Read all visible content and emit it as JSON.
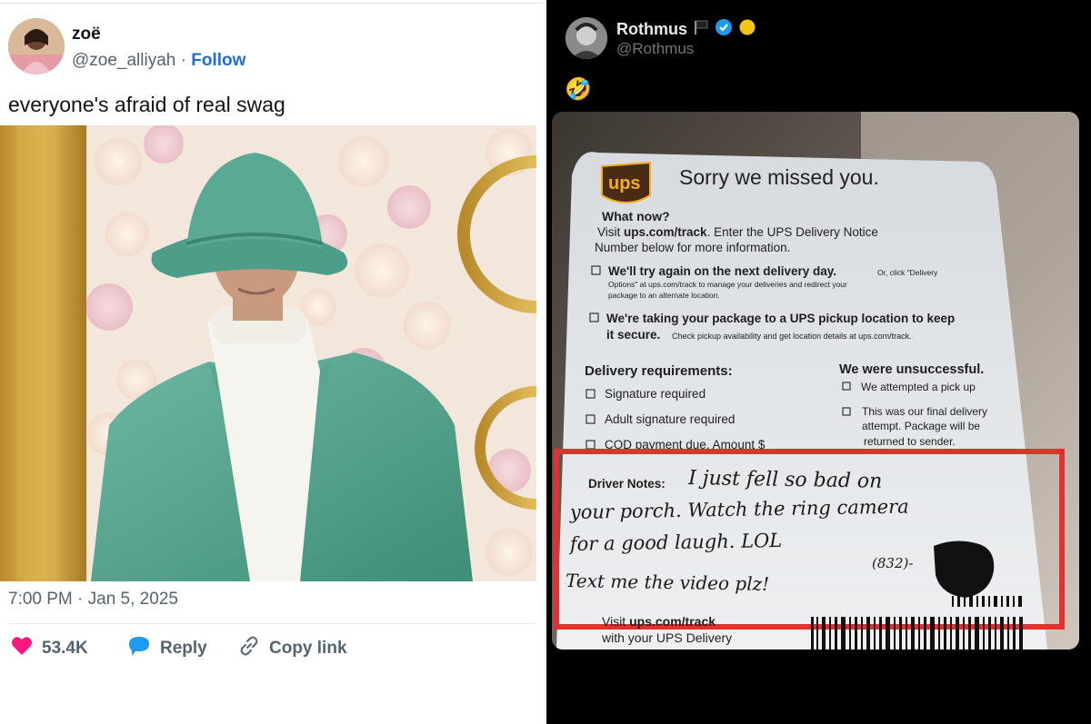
{
  "left_tweet": {
    "name": "zoë",
    "handle": "@zoe_alliyah",
    "separator": "·",
    "follow_label": "Follow",
    "text": "everyone's afraid of real swag",
    "timestamp": "7:00 PM · Jan 5, 2025",
    "likes": "53.4K",
    "reply_label": "Reply",
    "copy_link_label": "Copy link",
    "colors": {
      "like": "#f91880",
      "reply_icon": "#1d9bf0",
      "follow": "#1d6fd6"
    }
  },
  "right_tweet": {
    "name": "Rothmus",
    "handle": "@Rothmus",
    "name_emojis": [
      "black-flag-icon",
      "verified-badge-icon",
      "yellow-circle-icon"
    ],
    "text": "🤣",
    "note_card": {
      "brand": "ups",
      "title": "Sorry we missed you.",
      "what_now_heading": "What now?",
      "what_now_text_1": "Visit ",
      "what_now_link": "ups.com/track",
      "what_now_text_2": ". Enter the UPS Delivery Notice",
      "what_now_text_3": "Number below for more information.",
      "option_1_bold": "We'll try again on the next delivery day.",
      "option_1_small_1": "Or, click \"Delivery",
      "option_1_small_2": "Options\" at ups.com/track to manage your deliveries and redirect your",
      "option_1_small_3": "package to an alternate location.",
      "option_2_bold_1": "We're taking your package to a UPS pickup location to keep",
      "option_2_bold_2": "it secure.",
      "option_2_small": "Check pickup availability and get location details at ups.com/track.",
      "delivery_req_heading": "Delivery requirements:",
      "delivery_req": [
        "Signature required",
        "Adult signature required",
        "COD payment due. Amount $ ____"
      ],
      "unsuccessful_heading": "We were unsuccessful.",
      "unsuccessful": [
        "We attempted a pick up",
        "This was our final delivery",
        "attempt. Package will be",
        "returned to sender."
      ],
      "driver_notes_label": "Driver Notes:",
      "driver_notes_lines": [
        "I just fell so bad on",
        "your porch. Watch the ring camera",
        "for a good laugh. LOL",
        "Text me the video plz!"
      ],
      "phone_prefix": "(832)-",
      "footer_link_1": "Visit ",
      "footer_link_2": "ups.com/track",
      "footer_cut": "with your UPS Delivery",
      "highlight_color": "#e3312d"
    }
  }
}
